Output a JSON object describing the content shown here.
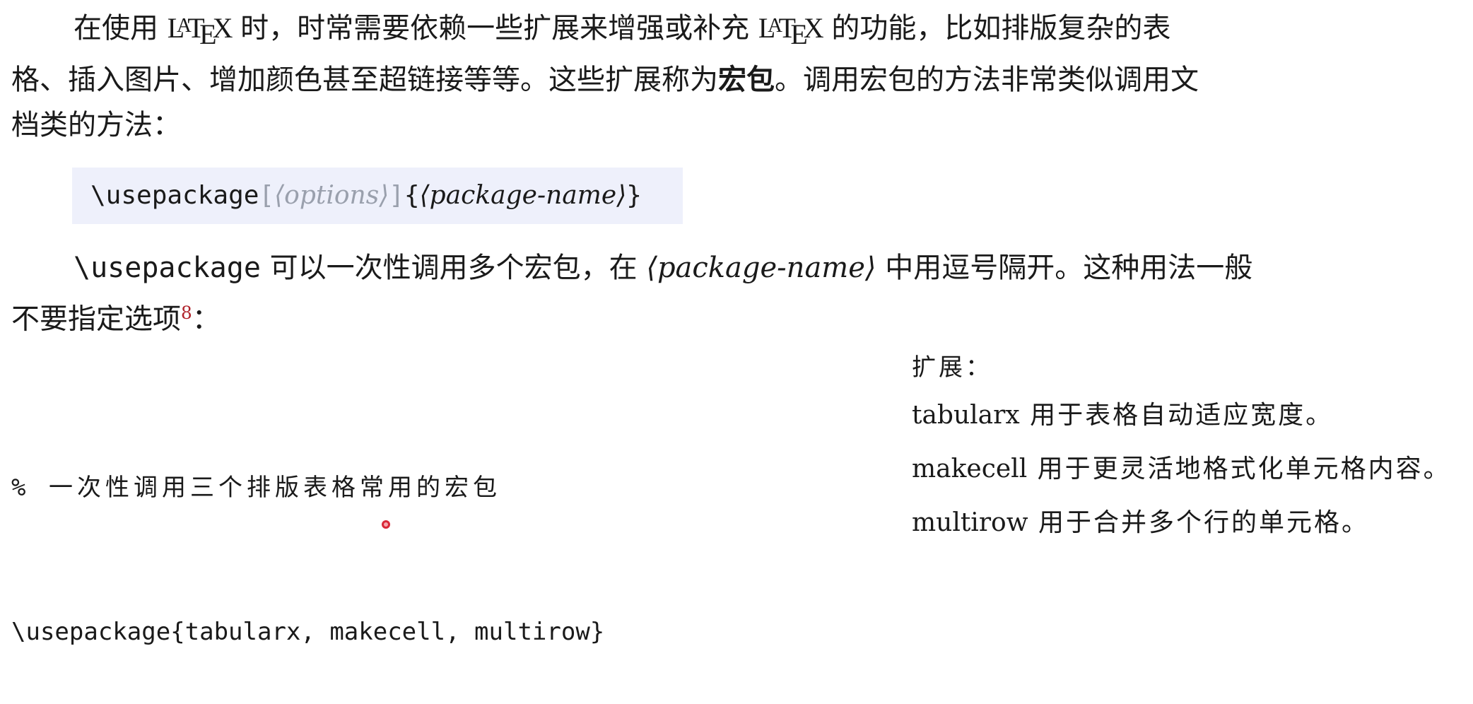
{
  "intro": {
    "l1_a": "在使用 ",
    "latex_l": "L",
    "latex_a": "A",
    "latex_t": "T",
    "latex_e": "E",
    "latex_x": "X",
    "l1_b": " 时，时常需要依赖一些扩展来增强或补充 ",
    "l1_c": " 的功能，比如排版复杂的表",
    "l2_a": "格、插入图片、增加颜色甚至超链接等等。这些扩展称为",
    "l2_bold": "宏包",
    "l2_b": "。调用宏包的方法非常类似调用文",
    "l3": "档类的方法："
  },
  "codebox": {
    "cmd": "\\usepackage",
    "open_bracket": "[",
    "options": "⟨options⟩",
    "close_bracket": "]",
    "open_brace": "{",
    "pkg": "⟨package-name⟩",
    "close_brace": "}"
  },
  "para2": {
    "cmd": "\\usepackage",
    "a": " 可以一次性调用多个宏包，在 ",
    "pkg": "⟨package-name⟩",
    "b": " 中用逗号隔开。这种用法一般",
    "c": "不要指定选项",
    "footnote": "8",
    "d": "："
  },
  "snippet": {
    "comment": "% 一次性调用三个排版表格常用的宏包",
    "code": "\\usepackage{tabularx, makecell, multirow}"
  },
  "notes": {
    "title": "扩展：",
    "items": [
      {
        "name": "tabularx",
        "desc": " 用于表格自动适应宽度。"
      },
      {
        "name": "makecell",
        "desc": " 用于更灵活地格式化单元格内容。"
      },
      {
        "name": "multirow",
        "desc": " 用于合并多个行的单元格。"
      }
    ]
  }
}
